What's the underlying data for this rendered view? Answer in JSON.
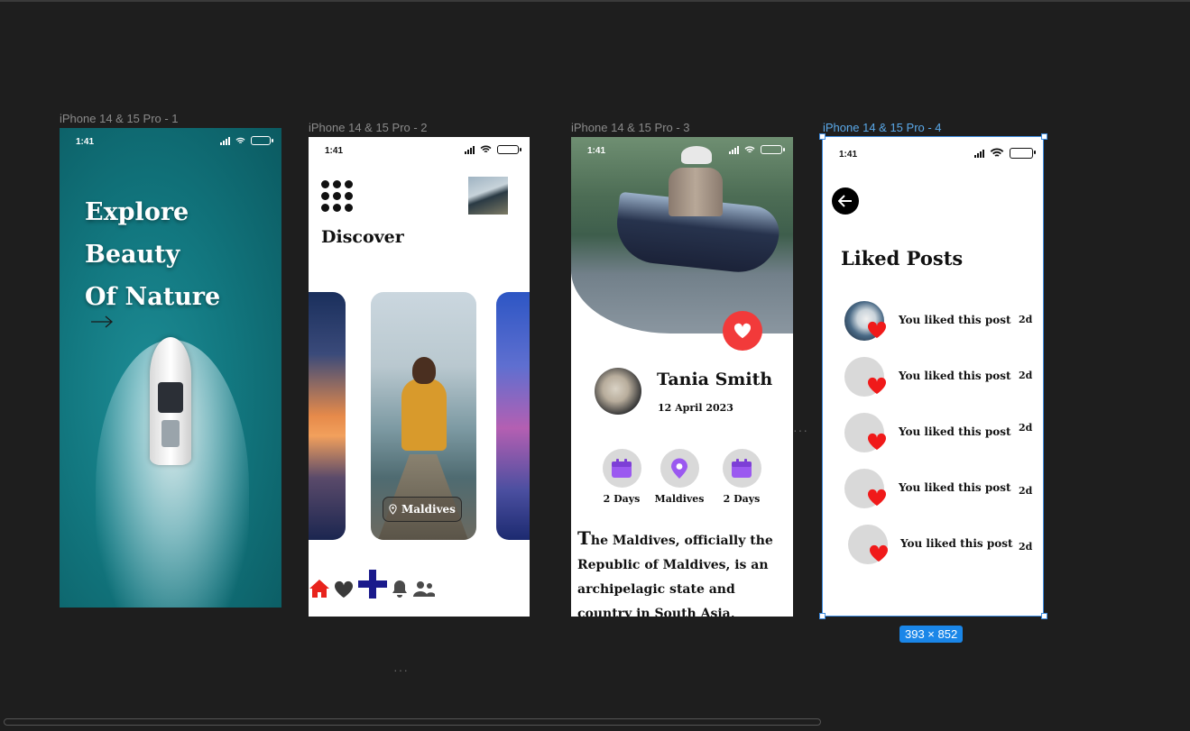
{
  "frames": [
    {
      "label": "iPhone 14 & 15 Pro - 1"
    },
    {
      "label": "iPhone 14 & 15 Pro - 2"
    },
    {
      "label": "iPhone 14 & 15 Pro - 3"
    },
    {
      "label": "iPhone 14 & 15 Pro - 4"
    }
  ],
  "status_time": "1:41",
  "screen1": {
    "hero_line1": "Explore",
    "hero_line2": "Beauty",
    "hero_line3": "Of Nature"
  },
  "screen2": {
    "heading": "Discover",
    "location_label": "Maldives",
    "active_tab_color": "#e8231c",
    "add_color": "#1a1a8c"
  },
  "screen3": {
    "name": "Tania Smith",
    "date": "12 April 2023",
    "stats": [
      {
        "label": "2 Days"
      },
      {
        "label": "Maldives"
      },
      {
        "label": "2 Days"
      }
    ],
    "paragraph_dropcap": "T",
    "paragraph_rest": "he Maldives, officially the Republic of Maldives, is an archipelagic state and country in South Asia, situated in the Indian",
    "heart_color": "#f23a3a",
    "icon_color": "#9b59f0"
  },
  "screen4": {
    "title": "Liked Posts",
    "items": [
      {
        "text": "You liked this post",
        "age": "2d"
      },
      {
        "text": "You liked this post",
        "age": "2d"
      },
      {
        "text": "You liked this post",
        "age": "2d"
      },
      {
        "text": "You liked this post",
        "age": "2d"
      },
      {
        "text": "You liked this post",
        "age": "2d"
      }
    ]
  },
  "selection_size": "393 × 852",
  "accent_selection": "#3e8de0"
}
